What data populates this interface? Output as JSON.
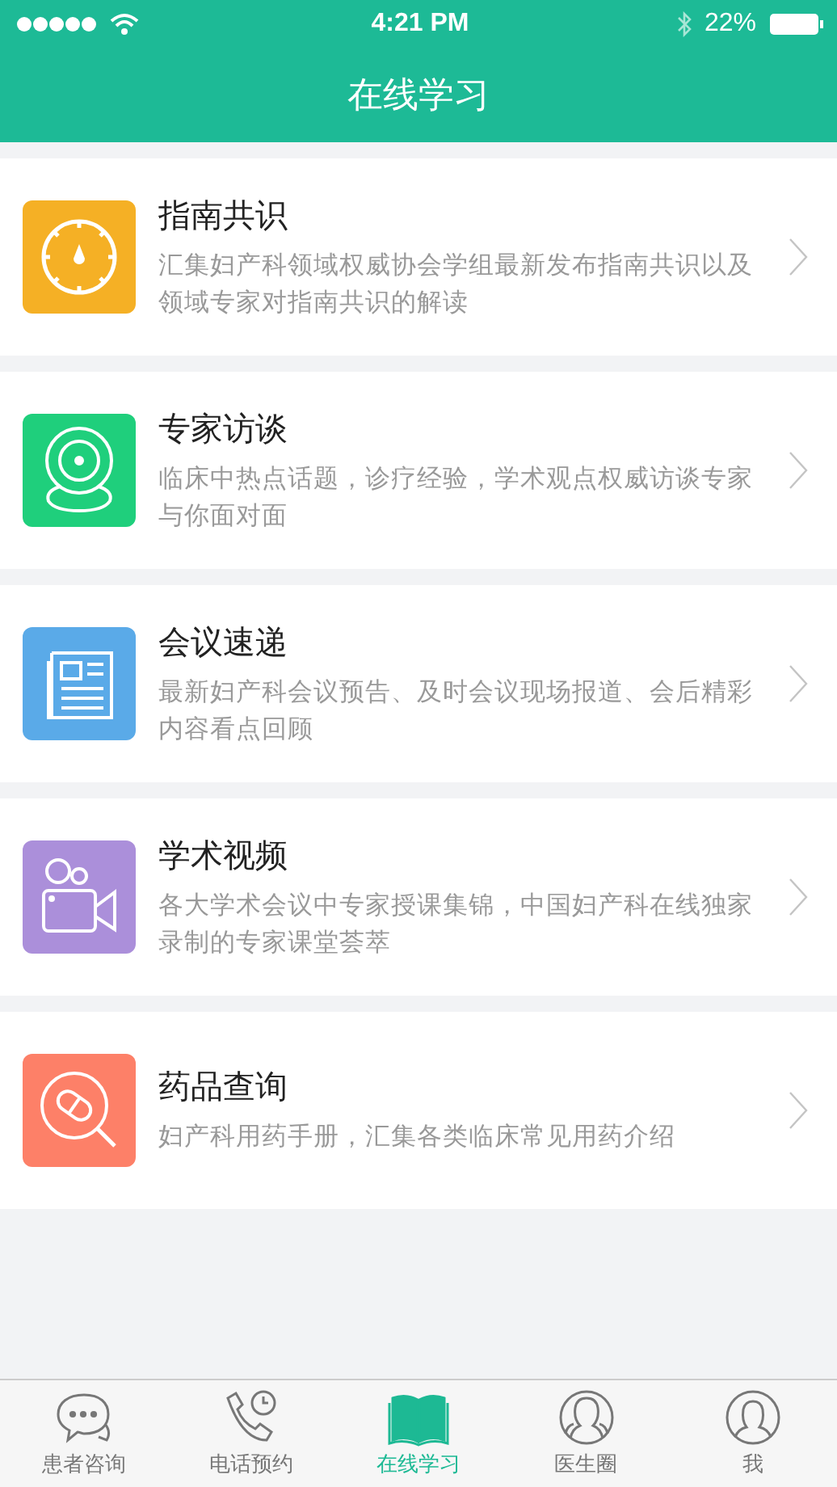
{
  "status_bar": {
    "time": "4:21 PM",
    "battery": "22%"
  },
  "header": {
    "title": "在线学习"
  },
  "items": [
    {
      "kind": "compass",
      "color": "#f5b025",
      "title": "指南共识",
      "description": "汇集妇产科领域权威协会学组最新发布指南共识以及领域专家对指南共识的解读"
    },
    {
      "kind": "camera",
      "color": "#1fcf7c",
      "title": "专家访谈",
      "description": "临床中热点话题，诊疗经验，学术观点权威访谈专家与你面对面"
    },
    {
      "kind": "news",
      "color": "#5aaae8",
      "title": "会议速递",
      "description": "最新妇产科会议预告、及时会议现场报道、会后精彩内容看点回顾"
    },
    {
      "kind": "video",
      "color": "#ab8fda",
      "title": "学术视频",
      "description": "各大学术会议中专家授课集锦，中国妇产科在线独家录制的专家课堂荟萃"
    },
    {
      "kind": "pill",
      "color": "#fd8068",
      "title": "药品查询",
      "description": "妇产科用药手册，汇集各类临床常见用药介绍"
    }
  ],
  "tab_bar": [
    {
      "kind": "chat",
      "label": "患者咨询",
      "selected": false
    },
    {
      "kind": "phone",
      "label": "电话预约",
      "selected": false
    },
    {
      "kind": "book",
      "label": "在线学习",
      "selected": true
    },
    {
      "kind": "group",
      "label": "医生圈",
      "selected": false
    },
    {
      "kind": "person",
      "label": "我",
      "selected": false
    }
  ]
}
